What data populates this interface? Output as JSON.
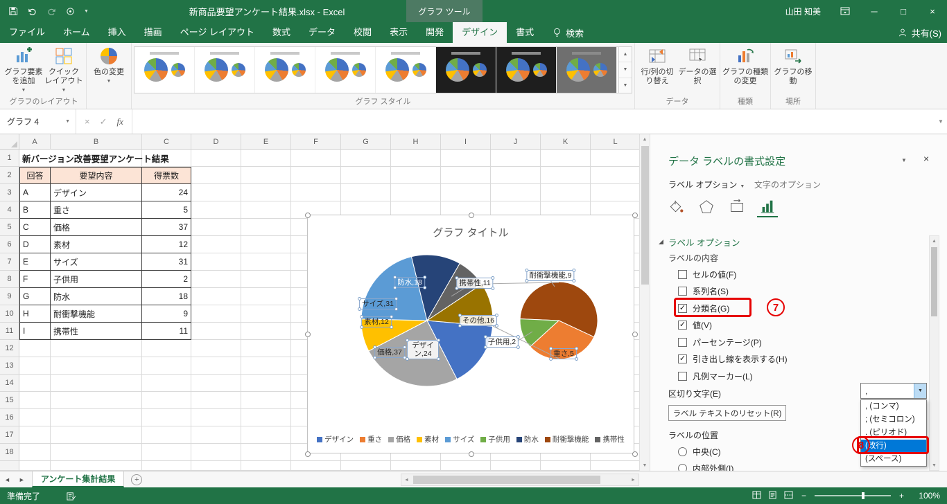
{
  "titlebar": {
    "document_title": "新商品要望アンケート結果.xlsx  -  Excel",
    "contextual_group": "グラフ ツール",
    "user": "山田 知美"
  },
  "ribbon": {
    "tabs": [
      "ファイル",
      "ホーム",
      "挿入",
      "描画",
      "ページ レイアウト",
      "数式",
      "データ",
      "校閲",
      "表示",
      "開発",
      "デザイン",
      "書式"
    ],
    "active_tab": "デザイン",
    "tell_me": "検索",
    "share": "共有(S)",
    "groups": [
      {
        "label": "グラフのレイアウト"
      },
      {
        "label": "グラフ スタイル"
      },
      {
        "label": "データ"
      },
      {
        "label": "種類"
      },
      {
        "label": "場所"
      }
    ],
    "buttons": {
      "add_chart_element": "グラフ要素を追加",
      "quick_layout": "クイック レイアウト",
      "change_colors": "色の変更",
      "switch_row_column": "行/列の切り替え",
      "select_data": "データの選択",
      "change_chart_type": "グラフの種類の変更",
      "move_chart": "グラフの移動"
    }
  },
  "formula_bar": {
    "name_box": "グラフ 4",
    "fx": "fx"
  },
  "grid": {
    "columns": [
      "A",
      "B",
      "C",
      "D",
      "E",
      "F",
      "G",
      "H",
      "I",
      "J",
      "K",
      "L"
    ],
    "rows": 18,
    "title_cell": "新バージョン改善要望アンケート結果",
    "table": {
      "headers": [
        "回答",
        "要望内容",
        "得票数"
      ],
      "rows": [
        [
          "A",
          "デザイン",
          "24"
        ],
        [
          "B",
          "重さ",
          "5"
        ],
        [
          "C",
          "価格",
          "37"
        ],
        [
          "D",
          "素材",
          "12"
        ],
        [
          "E",
          "サイズ",
          "31"
        ],
        [
          "F",
          "子供用",
          "2"
        ],
        [
          "G",
          "防水",
          "18"
        ],
        [
          "H",
          "耐衝撃機能",
          "9"
        ],
        [
          "I",
          "携帯性",
          "11"
        ]
      ]
    }
  },
  "chart_data": {
    "type": "pie",
    "subtype": "pie-of-pie",
    "title": "グラフ タイトル",
    "categories": [
      "デザイン",
      "重さ",
      "価格",
      "素材",
      "サイズ",
      "子供用",
      "防水",
      "耐衝撃機能",
      "携帯性"
    ],
    "values": [
      24,
      5,
      37,
      12,
      31,
      2,
      18,
      9,
      11
    ],
    "label_separator": ",",
    "main_pie": {
      "start_angle": 95,
      "slices": [
        {
          "label": "デザイン",
          "value": 24,
          "color": "#4472C4"
        },
        {
          "label": "価格",
          "value": 37,
          "color": "#A5A5A5"
        },
        {
          "label": "素材",
          "value": 12,
          "color": "#FFC000"
        },
        {
          "label": "サイズ",
          "value": 31,
          "color": "#5B9BD5"
        },
        {
          "label": "防水",
          "value": 18,
          "color": "#264478"
        },
        {
          "label": "携帯性",
          "value": 11,
          "color": "#636363"
        },
        {
          "label": "その他",
          "value": 16,
          "color": "#997300"
        }
      ]
    },
    "secondary_pie": {
      "start_angle": 272.5,
      "slices": [
        {
          "label": "耐衝撃機能",
          "value": 9,
          "color": "#9E480E"
        },
        {
          "label": "重さ",
          "value": 5,
          "color": "#ED7D31"
        },
        {
          "label": "子供用",
          "value": 2,
          "color": "#70AD47"
        }
      ]
    },
    "legend": [
      {
        "label": "デザイン",
        "color": "#4472C4"
      },
      {
        "label": "重さ",
        "color": "#ED7D31"
      },
      {
        "label": "価格",
        "color": "#A5A5A5"
      },
      {
        "label": "素材",
        "color": "#FFC000"
      },
      {
        "label": "サイズ",
        "color": "#5B9BD5"
      },
      {
        "label": "子供用",
        "color": "#70AD47"
      },
      {
        "label": "防水",
        "color": "#264478"
      },
      {
        "label": "耐衝撃機能",
        "color": "#9E480E"
      },
      {
        "label": "携帯性",
        "color": "#636363"
      }
    ],
    "legend_position": "bottom"
  },
  "task_pane": {
    "title": "データ ラベルの書式設定",
    "tab_label_options": "ラベル オプション",
    "tab_text_options": "文字のオプション",
    "section_label_options": "ラベル オプション",
    "section_label_contents": "ラベルの内容",
    "checkboxes": [
      {
        "label": "セルの値(F)",
        "checked": false
      },
      {
        "label": "系列名(S)",
        "checked": false
      },
      {
        "label": "分類名(G)",
        "checked": true,
        "highlighted": true
      },
      {
        "label": "値(V)",
        "checked": true
      },
      {
        "label": "パーセンテージ(P)",
        "checked": false
      },
      {
        "label": "引き出し線を表示する(H)",
        "checked": true
      },
      {
        "label": "凡例マーカー(L)",
        "checked": false
      }
    ],
    "separator_label": "区切り文字(E)",
    "separator_value": ",",
    "separator_options": [
      {
        "label": ", (コンマ)"
      },
      {
        "label": "; (セミコロン)"
      },
      {
        "label": ". (ピリオド)"
      },
      {
        "label": "(改行)",
        "highlighted": true
      },
      {
        "label": "(スペース)"
      }
    ],
    "reset_button": "ラベル テキストのリセット(R)",
    "label_position_label": "ラベルの位置",
    "position_options": [
      {
        "label": "中央(C)",
        "selected": false
      },
      {
        "label": "内部外側(I)",
        "selected": false
      }
    ]
  },
  "sheet_bar": {
    "tabs": [
      {
        "label": "アンケート集計結果",
        "active": true
      }
    ]
  },
  "status_bar": {
    "ready": "準備完了",
    "zoom": "100%",
    "zoom_out": "−",
    "zoom_in": "+"
  },
  "annotations": {
    "step7": "7",
    "step8": "8"
  }
}
